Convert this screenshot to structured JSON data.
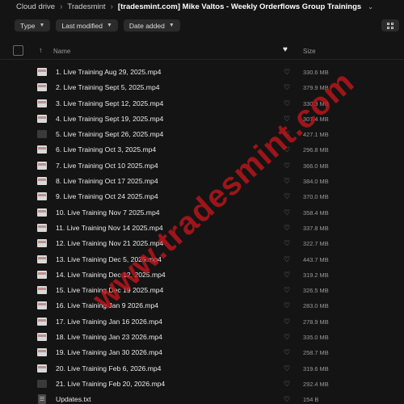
{
  "breadcrumb": {
    "root": "Cloud drive",
    "parent": "Tradesmint",
    "current": "[tradesmint.com] Mike Valtos - Weekly Orderflows Group Trainings"
  },
  "filters": [
    {
      "label": "Type"
    },
    {
      "label": "Last modified"
    },
    {
      "label": "Date added"
    }
  ],
  "table": {
    "col_name": "Name",
    "col_size": "Size"
  },
  "files": [
    {
      "name": "1. Live Training Aug 29, 2025.mp4",
      "size": "330.6 MB",
      "thumb": "video"
    },
    {
      "name": "2. Live Training Sept 5, 2025.mp4",
      "size": "379.9 MB",
      "thumb": "video"
    },
    {
      "name": "3. Live Training Sept 12, 2025.mp4",
      "size": "330.3 MB",
      "thumb": "video"
    },
    {
      "name": "4. Live Training Sept 19, 2025.mp4",
      "size": "307.4 MB",
      "thumb": "video"
    },
    {
      "name": "5. Live Training Sept 26, 2025.mp4",
      "size": "427.1 MB",
      "thumb": "video-dark"
    },
    {
      "name": "6. Live Training Oct 3, 2025.mp4",
      "size": "296.8 MB",
      "thumb": "video"
    },
    {
      "name": "7. Live Training Oct 10 2025.mp4",
      "size": "366.0 MB",
      "thumb": "video"
    },
    {
      "name": "8. Live Training Oct 17 2025.mp4",
      "size": "384.0 MB",
      "thumb": "video"
    },
    {
      "name": "9. Live Training Oct 24 2025.mp4",
      "size": "370.0 MB",
      "thumb": "video"
    },
    {
      "name": "10. Live Training Nov 7 2025.mp4",
      "size": "358.4 MB",
      "thumb": "video"
    },
    {
      "name": "11. Live Training Nov 14 2025.mp4",
      "size": "337.8 MB",
      "thumb": "video"
    },
    {
      "name": "12. Live Training Nov 21 2025.mp4",
      "size": "322.7 MB",
      "thumb": "video"
    },
    {
      "name": "13. Live Training Dec 5, 2025.mp4",
      "size": "443.7 MB",
      "thumb": "video"
    },
    {
      "name": "14. Live Training Dec 12, 2025.mp4",
      "size": "319.2 MB",
      "thumb": "video"
    },
    {
      "name": "15. Live Training Dec 19 2025.mp4",
      "size": "326.5 MB",
      "thumb": "video"
    },
    {
      "name": "16. Live Training Jan 9 2026.mp4",
      "size": "283.0 MB",
      "thumb": "video"
    },
    {
      "name": "17. Live Training Jan 16 2026.mp4",
      "size": "278.9 MB",
      "thumb": "video"
    },
    {
      "name": "18. Live Training Jan 23 2026.mp4",
      "size": "335.0 MB",
      "thumb": "video"
    },
    {
      "name": "19. Live Training Jan 30 2026.mp4",
      "size": "258.7 MB",
      "thumb": "video"
    },
    {
      "name": "20. Live Training Feb 6, 2026.mp4",
      "size": "319.6 MB",
      "thumb": "video"
    },
    {
      "name": "21. Live Training Feb 20, 2026.mp4",
      "size": "292.4 MB",
      "thumb": "video-dark"
    },
    {
      "name": "Updates.txt",
      "size": "154 B",
      "thumb": "doc"
    }
  ],
  "watermark": "www.tradesmint.com",
  "colors": {
    "background": "#141414",
    "chip": "#2b2b2b",
    "watermark": "#c4161c"
  },
  "icons": {
    "favorite_header": "heart-icon",
    "favorite_row": "heart-outline-icon",
    "sort": "arrow-up-icon",
    "view_toggle": "grid-icon"
  }
}
